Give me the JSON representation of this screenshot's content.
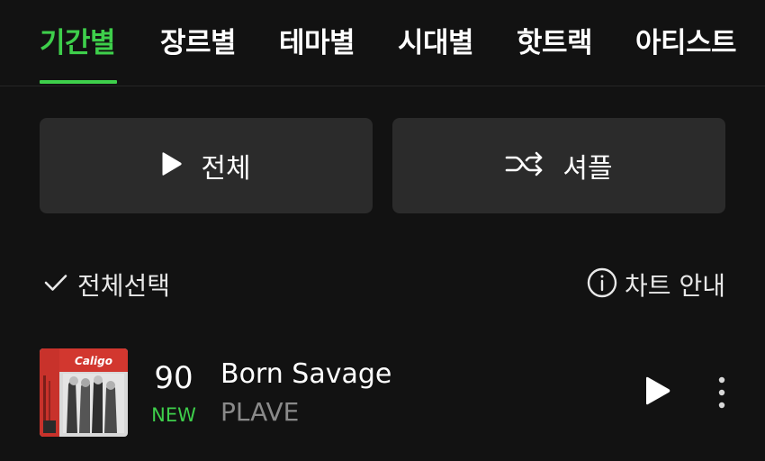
{
  "tabs": [
    {
      "label": "기간별",
      "active": true
    },
    {
      "label": "장르별",
      "active": false
    },
    {
      "label": "테마별",
      "active": false
    },
    {
      "label": "시대별",
      "active": false
    },
    {
      "label": "핫트랙",
      "active": false
    },
    {
      "label": "아티스트",
      "active": false
    }
  ],
  "actions": {
    "play_all_label": "전체",
    "shuffle_label": "셔플"
  },
  "list_controls": {
    "select_all_label": "전체선택",
    "chart_info_label": "차트 안내"
  },
  "tracks": [
    {
      "rank": "90",
      "badge": "NEW",
      "title": "Born Savage",
      "artist": "PLAVE",
      "album_art_text": "Caligo"
    }
  ],
  "colors": {
    "accent": "#3ecf4b",
    "background": "#121212",
    "button_bg": "#2b2b2b",
    "secondary_text": "#8a8a8a"
  },
  "icons": {
    "play_all": "play-icon",
    "shuffle": "shuffle-icon",
    "select_all": "checkmark-icon",
    "chart_info": "info-icon",
    "track_play": "play-icon",
    "track_more": "more-vertical-icon"
  }
}
